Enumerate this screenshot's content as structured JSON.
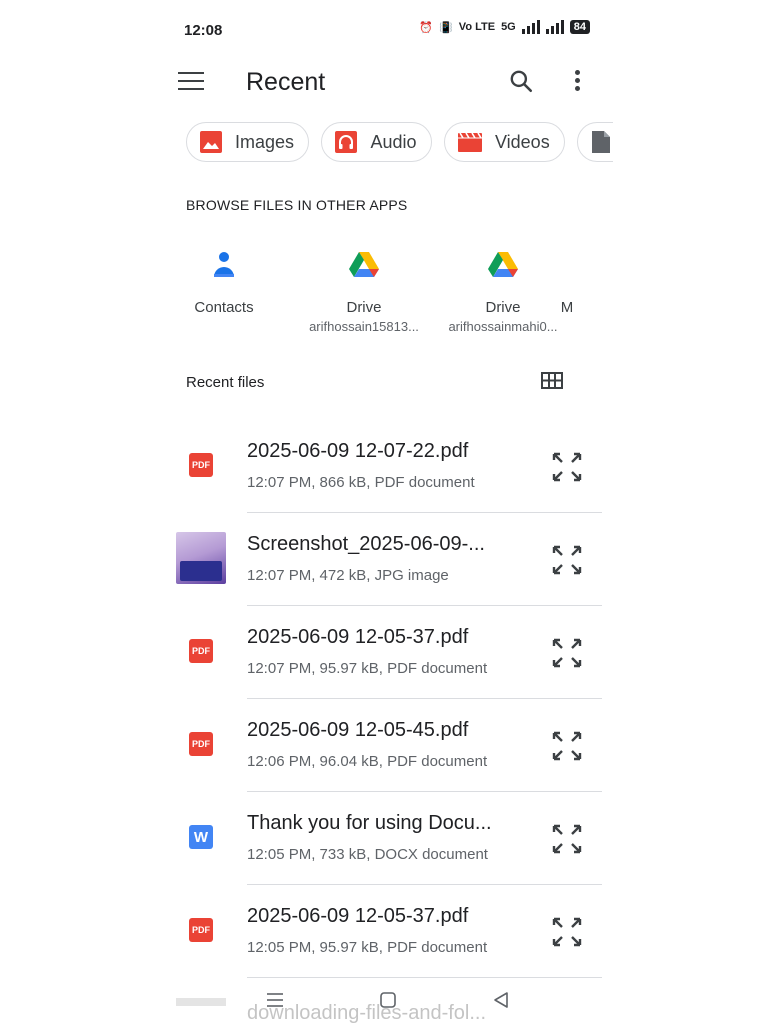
{
  "status_bar": {
    "time": "12:08",
    "volte_text": "Vo LTE",
    "net_text": "5G",
    "battery": "84"
  },
  "header": {
    "title": "Recent"
  },
  "chips": [
    {
      "label": "Images",
      "icon": "image-icon",
      "color": "#ea4335"
    },
    {
      "label": "Audio",
      "icon": "headphones-icon",
      "color": "#ea4335"
    },
    {
      "label": "Videos",
      "icon": "movie-icon",
      "color": "#ea4335"
    },
    {
      "label": "",
      "icon": "document-icon",
      "color": "#5f6368"
    }
  ],
  "browse": {
    "heading": "BROWSE FILES IN OTHER APPS",
    "apps": [
      {
        "name": "Contacts",
        "sub": "",
        "icon": "contacts-icon"
      },
      {
        "name": "Drive",
        "sub": "arifhossain15813...",
        "icon": "drive-icon"
      },
      {
        "name": "Drive",
        "sub": "arifhossainmahi0...",
        "icon": "drive-icon"
      },
      {
        "name": "M",
        "sub": "",
        "icon": ""
      }
    ]
  },
  "recent": {
    "heading": "Recent files",
    "files": [
      {
        "name": "2025-06-09 12-07-22.pdf",
        "meta": "12:07 PM, 866 kB, PDF document",
        "type": "pdf",
        "badge": "PDF"
      },
      {
        "name": "Screenshot_2025-06-09-...",
        "meta": "12:07 PM, 472 kB, JPG image",
        "type": "image",
        "badge": ""
      },
      {
        "name": "2025-06-09 12-05-37.pdf",
        "meta": "12:07 PM, 95.97 kB, PDF document",
        "type": "pdf",
        "badge": "PDF"
      },
      {
        "name": "2025-06-09 12-05-45.pdf",
        "meta": "12:06 PM, 96.04 kB, PDF document",
        "type": "pdf",
        "badge": "PDF"
      },
      {
        "name": "Thank you for using Docu...",
        "meta": "12:05 PM, 733 kB, DOCX document",
        "type": "docx",
        "badge": "W"
      },
      {
        "name": "2025-06-09 12-05-37.pdf",
        "meta": "12:05 PM, 95.97 kB, PDF document",
        "type": "pdf",
        "badge": "PDF"
      }
    ],
    "partial_next": "downloading-files-and-fol..."
  },
  "colors": {
    "accent": "#ea4335",
    "doc_blue": "#4285f4",
    "text": "#202124",
    "secondary": "#5f6368"
  }
}
